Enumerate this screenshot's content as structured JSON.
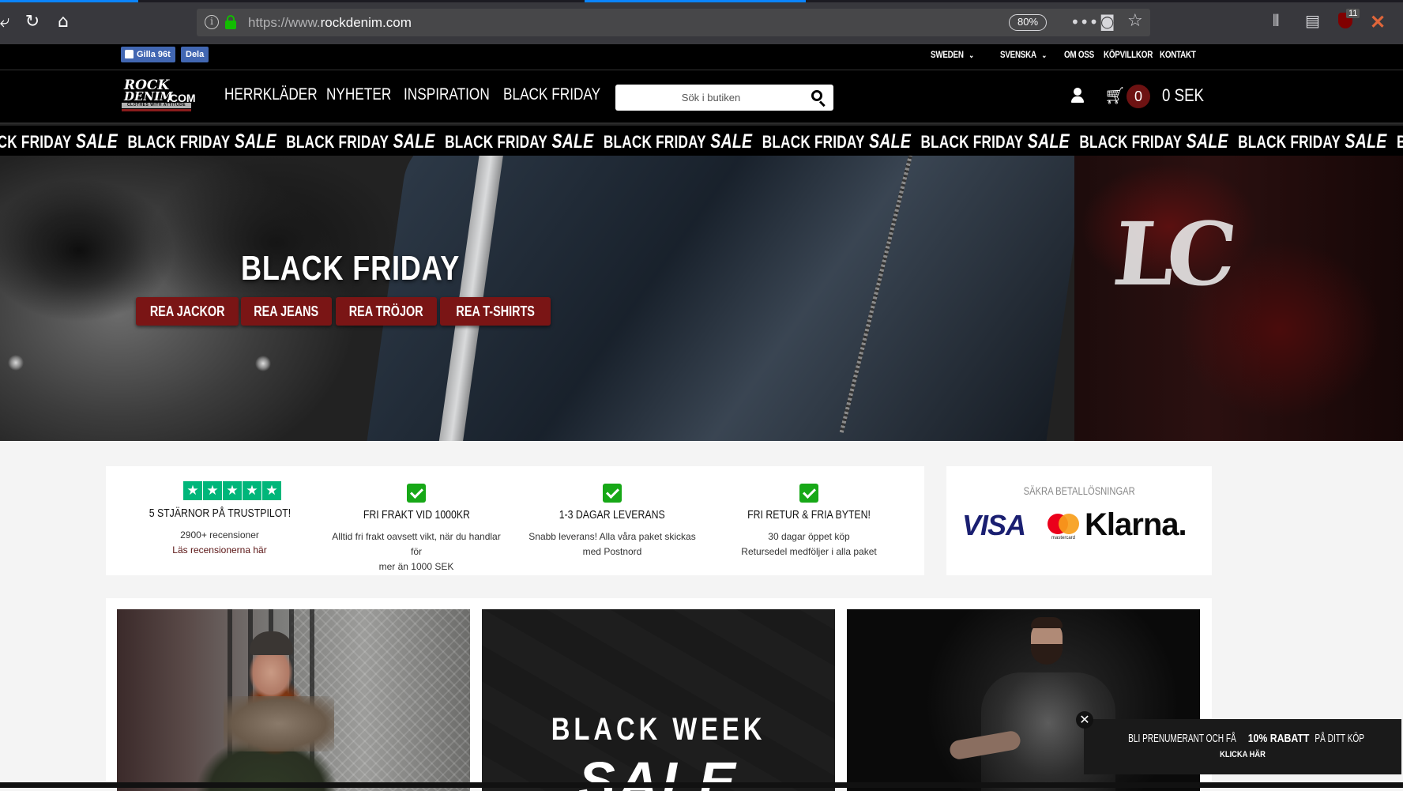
{
  "browser": {
    "url_prefix": "https://www.",
    "url_domain": "rockdenim.com",
    "zoom": "80%",
    "ublock_count": "11",
    "icons": [
      "reload-icon",
      "home-icon",
      "info-icon",
      "lock-icon",
      "more-icon",
      "pocket-icon",
      "star-icon",
      "library-icon",
      "sidebar-icon",
      "ublock-icon"
    ]
  },
  "topbar": {
    "fb_like": "Gilla 96t",
    "fb_share": "Dela",
    "links": [
      "SWEDEN",
      "SVENSKA",
      "OM OSS",
      "KÖPVILLKOR",
      "KONTAKT"
    ]
  },
  "header": {
    "logo_line1": "ROCK",
    "logo_line2": "DENIM",
    "logo_suffix": ".COM",
    "logo_tagline": "CLOTHES WITH ATTITUDE",
    "nav": [
      "HERRKLÄDER",
      "NYHETER",
      "INSPIRATION",
      "BLACK FRIDAY"
    ],
    "search_placeholder": "Sök i butiken",
    "cart_count": "0",
    "cart_total": "0 SEK"
  },
  "ticker": {
    "text": "BLACK FRIDAY",
    "sale": "SALE",
    "lead": "ACK FRIDAY"
  },
  "hero": {
    "title": "BLACK FRIDAY",
    "buttons": [
      "REA JACKOR",
      "REA JEANS",
      "REA TRÖJOR",
      "REA T-SHIRTS"
    ]
  },
  "usp": {
    "trustpilot": {
      "title": "5 STJÄRNOR PÅ TRUSTPILOT!",
      "text": "2900+ recensioner",
      "link": "Läs recensionerna här",
      "stars": 5
    },
    "items": [
      {
        "title": "FRI FRAKT VID 1000KR",
        "line1": "Alltid fri frakt oavsett vikt, när du handlar för",
        "line2": "mer än 1000 SEK"
      },
      {
        "title": "1-3 DAGAR LEVERANS",
        "line1": "Snabb leverans! Alla våra paket skickas",
        "line2": "med Postnord"
      },
      {
        "title": "FRI RETUR & FRIA BYTEN!",
        "line1": "30 dagar öppet köp",
        "line2": "Retursedel medföljer i alla paket"
      }
    ]
  },
  "payments": {
    "title": "SÄKRA BETALLÖSNINGAR",
    "visa": "VISA",
    "mastercard": "mastercard",
    "klarna": "Klarna."
  },
  "tiles": {
    "black_week": "BLACK WEEK",
    "sale": "SALE"
  },
  "newsletter": {
    "text_pre": "BLI PRENUMERANT OCH FÅ ",
    "text_bold": "10% RABATT",
    "text_post": " PÅ DITT KÖP",
    "link": "KLICKA HÄR"
  },
  "colors": {
    "accent": "#7a1515",
    "trustpilot_green": "#00b67a",
    "check_green": "#17a817",
    "visa_blue": "#1a1f71"
  }
}
